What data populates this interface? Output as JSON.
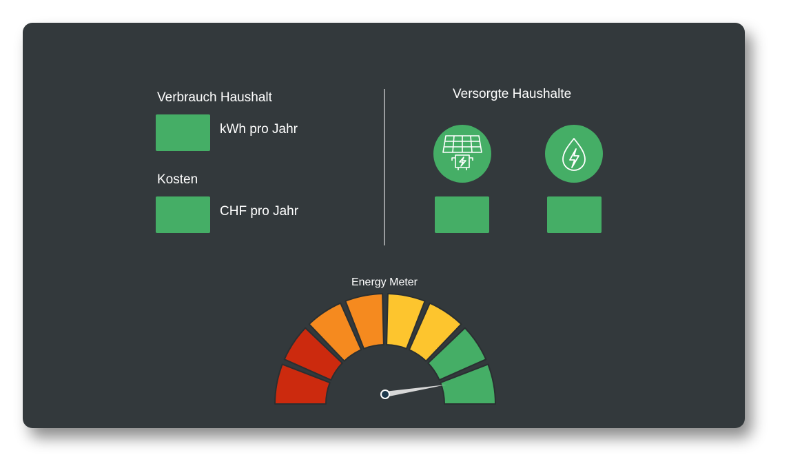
{
  "left_panel": {
    "consumption_heading": "Verbrauch Haushalt",
    "consumption_value": "",
    "consumption_unit": "kWh pro Jahr",
    "cost_heading": "Kosten",
    "cost_value": "",
    "cost_unit": "CHF pro Jahr"
  },
  "right_panel": {
    "heading": "Versorgte Haushalte",
    "items": [
      {
        "icon": "solar-panel-icon",
        "value": ""
      },
      {
        "icon": "water-drop-bolt-icon",
        "value": ""
      }
    ]
  },
  "meter": {
    "title": "Energy Meter",
    "segment_colors": [
      "#cc2a0e",
      "#cc2a0e",
      "#f58a1f",
      "#f58a1f",
      "#fdc52e",
      "#fdc52e",
      "#45ae66",
      "#45ae66"
    ],
    "needle_fraction": 0.95
  },
  "colors": {
    "background": "#33393c",
    "accent": "#45ae66"
  }
}
